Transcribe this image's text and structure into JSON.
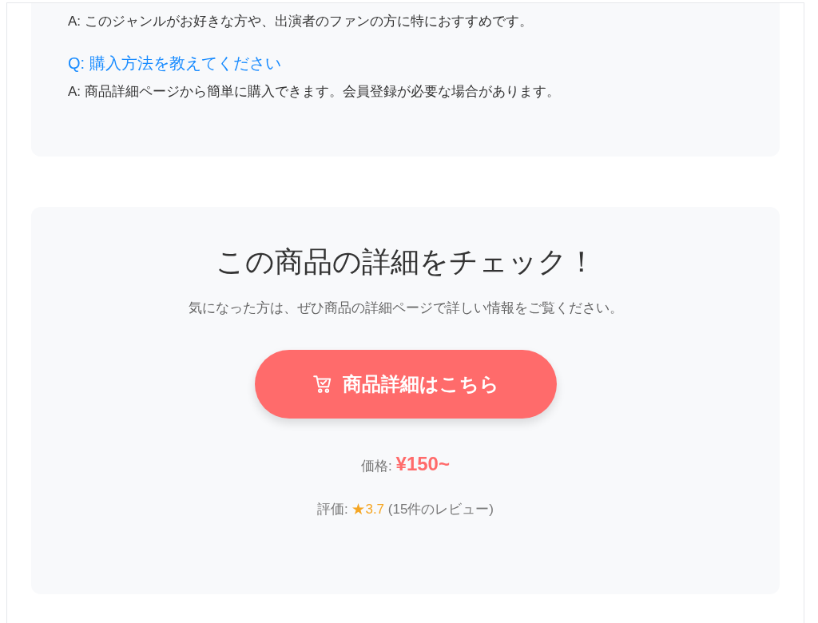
{
  "faq": [
    {
      "kind": "answer",
      "text": "A: このジャンルがお好きな方や、出演者のファンの方に特におすすめです。"
    },
    {
      "kind": "question",
      "text": "Q: 購入方法を教えてください"
    },
    {
      "kind": "answer",
      "text": "A: 商品詳細ページから簡単に購入できます。会員登録が必要な場合があります。"
    }
  ],
  "cta": {
    "title": "この商品の詳細をチェック！",
    "subtitle": "気になった方は、ぜひ商品の詳細ページで詳しい情報をご覧ください。",
    "button": "商品詳細はこちら",
    "price_label": "価格:",
    "price": "¥150~",
    "rating_label": "評価:",
    "rating_star": "★",
    "rating_score": "3.7",
    "rating_count": "(15件のレビュー)"
  }
}
